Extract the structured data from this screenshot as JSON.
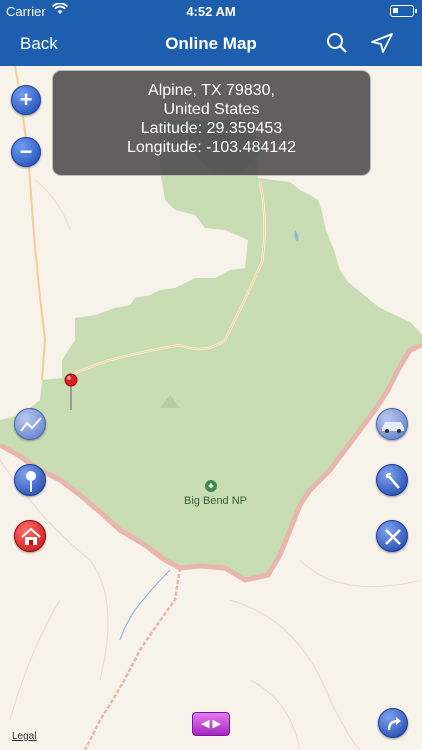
{
  "status_bar": {
    "carrier": "Carrier",
    "time": "4:52 AM"
  },
  "nav": {
    "back_label": "Back",
    "title": "Online Map",
    "search_icon": "search-icon",
    "locate_icon": "location-arrow-icon"
  },
  "info": {
    "line1": "Alpine, TX  79830,",
    "line2": "United States",
    "line3": "Latitude: 29.359453",
    "line4": "Longitude: -103.484142"
  },
  "map": {
    "park_label": "Big Bend NP",
    "legal": "Legal",
    "colors": {
      "park": "#c8ddb4",
      "background": "#f7f2ea",
      "border": "#e8b6ad",
      "nav": "#1d5fae"
    }
  },
  "buttons": {
    "zoom_in": "+",
    "zoom_out": "−",
    "swipe": "◀ ▶"
  }
}
